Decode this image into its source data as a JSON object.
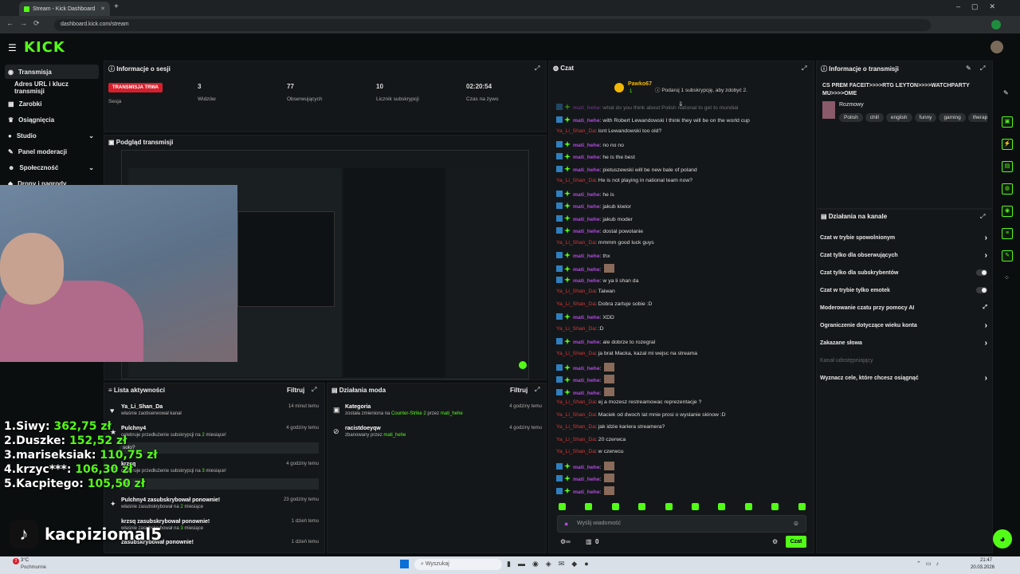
{
  "browser": {
    "tab_title": "Stream - Kick Dashboard",
    "url": "dashboard.kick.com/stream",
    "new_tab": "+"
  },
  "app": {
    "logo": "KICK"
  },
  "sidebar": {
    "items": [
      {
        "label": "Transmisja",
        "icon": "broadcast-icon"
      },
      {
        "label": "Adres URL i klucz transmisji",
        "icon": ""
      },
      {
        "label": "Zarobki",
        "icon": "money-icon"
      },
      {
        "label": "Osiągnięcia",
        "icon": "trophy-icon"
      },
      {
        "label": "Studio",
        "icon": "studio-icon"
      },
      {
        "label": "Panel moderacji",
        "icon": "moderation-icon"
      },
      {
        "label": "Społeczność",
        "icon": "community-icon"
      },
      {
        "label": "Dropy i nagrody",
        "icon": "drops-icon"
      }
    ]
  },
  "session": {
    "title": "Informacje o sesji",
    "status": "TRANSMISJA TRWA",
    "status_label": "Sesja",
    "stats": [
      {
        "value": "3",
        "label": "Widzów"
      },
      {
        "value": "77",
        "label": "Obserwujących"
      },
      {
        "value": "10",
        "label": "Licznik subskrypcji"
      },
      {
        "value": "02:20:54",
        "label": "Czas na żywo"
      }
    ]
  },
  "preview": {
    "title": "Podgląd transmisji"
  },
  "activity": {
    "title": "Lista aktywności",
    "filter": "Filtruj",
    "items": [
      {
        "name": "Ya_Li_Shan_Da",
        "desc": "właśnie zaobserwował kanał",
        "time": "14 minut temu",
        "msg": ""
      },
      {
        "name": "Pulchny4",
        "desc_a": "celebruje przedłużenie subskrypcji na ",
        "count": "2",
        "desc_b": " miesiące!",
        "time": "4 godziny temu",
        "msg": "solo?"
      },
      {
        "name": "krzsq",
        "desc_a": "celebruje przedłużenie subskrypcji na ",
        "count": "3",
        "desc_b": " miesiące!",
        "time": "4 godziny temu",
        "msg": "jol"
      },
      {
        "name": "Pulchny4 zasubskrybował ponownie!",
        "desc_a": "właśnie zasubskrybował na ",
        "count": "2",
        "desc_b": " miesiące",
        "time": "23 godziny temu"
      },
      {
        "name": "krzsq zasubskrybował ponownie!",
        "desc_a": "właśnie zasubskrybował na ",
        "count": "3",
        "desc_b": " miesiące",
        "time": "1 dzień temu"
      },
      {
        "name": "zasubskrybował ponownie!",
        "time": "1 dzień temu"
      }
    ]
  },
  "mod": {
    "title": "Działania moda",
    "filter": "Filtruj",
    "items": [
      {
        "name": "Kategoria",
        "desc_a": "została zmieniona na ",
        "highlight": "Counter-Strike 2",
        "desc_b": " przez ",
        "by": "mati_hehe",
        "time": "4 godziny temu"
      },
      {
        "name": "racistdoeyqw",
        "desc_a": "zbanowany przez ",
        "by": "mati_hehe",
        "time": "4 godziny temu"
      }
    ]
  },
  "chat": {
    "title": "Czat",
    "top_user": "Pawko67",
    "top_count": "1",
    "promo": "Podaruj 1 subskrypcję, aby zdobyć 2.",
    "cut_line": "what do you think about Polish national to get to mundial",
    "lines": [
      {
        "user": "mati_hehe",
        "badge": true,
        "text": "with Robert Lewandowski I think they will be on the world cup"
      },
      {
        "user": "Ya_Li_Shan_Da",
        "badge": false,
        "text": "isnt Lewandowski too old?"
      },
      {
        "user": "mati_hehe",
        "badge": true,
        "text": "no no no"
      },
      {
        "user": "mati_hehe",
        "badge": true,
        "text": "he is the best"
      },
      {
        "user": "mati_hehe",
        "badge": true,
        "text": "pietuszewski will be new bale of poland"
      },
      {
        "user": "Ya_Li_Shan_Da",
        "badge": false,
        "text": "He is not playing in national team now?"
      },
      {
        "user": "mati_hehe",
        "badge": true,
        "text": "he is"
      },
      {
        "user": "mati_hehe",
        "badge": true,
        "text": "jakub kiwior"
      },
      {
        "user": "mati_hehe",
        "badge": true,
        "text": "jakub moder"
      },
      {
        "user": "mati_hehe",
        "badge": true,
        "text": "dostal powolanie"
      },
      {
        "user": "Ya_Li_Shan_Da",
        "badge": false,
        "text": "mmmm good luck guys"
      },
      {
        "user": "mati_hehe",
        "badge": true,
        "text": "thx"
      },
      {
        "user": "mati_hehe",
        "badge": true,
        "text": ""
      },
      {
        "user": "mati_hehe",
        "badge": true,
        "text": "w ya li shan da"
      },
      {
        "user": "Ya_Li_Shan_Da",
        "badge": false,
        "text": "Taiwan"
      },
      {
        "user": "Ya_Li_Shan_Da",
        "badge": false,
        "text": "Dobra zartuje sobie :D"
      },
      {
        "user": "mati_hehe",
        "badge": true,
        "text": "XDD"
      },
      {
        "user": "Ya_Li_Shan_Da",
        "badge": false,
        "text": ":D"
      },
      {
        "user": "mati_hehe",
        "badge": true,
        "text": "ale dobrze to rozegral"
      },
      {
        "user": "Ya_Li_Shan_Da",
        "badge": false,
        "text": "ja brat Macka, kazal mi wejsc na streama"
      },
      {
        "user": "mati_hehe",
        "badge": true,
        "text": ""
      },
      {
        "user": "mati_hehe",
        "badge": true,
        "text": ""
      },
      {
        "user": "mati_hehe",
        "badge": true,
        "text": ""
      },
      {
        "user": "Ya_Li_Shan_Da",
        "badge": false,
        "text": "ej a mozesz restreamowac reprezentacje ?"
      },
      {
        "user": "Ya_Li_Shan_Da",
        "badge": false,
        "text": "Maciek od dwoch lat mnie prosi o wyslanie skinow :D"
      },
      {
        "user": "Ya_Li_Shan_Da",
        "badge": false,
        "text": "jak idzie kariera streamera?"
      },
      {
        "user": "Ya_Li_Shan_Da",
        "badge": false,
        "text": "20 czerwca"
      },
      {
        "user": "Ya_Li_Shan_Da",
        "badge": false,
        "text": "w czerwcu"
      },
      {
        "user": "mati_hehe",
        "badge": true,
        "text": ""
      },
      {
        "user": "mati_hehe",
        "badge": true,
        "text": ""
      },
      {
        "user": "mati_hehe",
        "badge": true,
        "text": ""
      }
    ],
    "input_placeholder": "Wyślij wiadomość",
    "points": "0",
    "send": "Czat"
  },
  "stream_info": {
    "title": "Informacje o transmisji",
    "stream_title": "CS PREM FACEIT>>>>RTG LEYTON>>>>WATCHPARTY MU>>>>OME",
    "category": "Rozmowy",
    "tags": [
      "Polish",
      "chill",
      "english",
      "funny",
      "gaming",
      "therap"
    ]
  },
  "channel": {
    "title": "Działania na kanale",
    "options": [
      {
        "label": "Czat w trybie spowolnionym",
        "kind": "arrow"
      },
      {
        "label": "Czat tylko dla obserwujących",
        "kind": "arrow"
      },
      {
        "label": "Czat tylko dla subskrybentów",
        "kind": "toggle"
      },
      {
        "label": "Czat w trybie tylko emotek",
        "kind": "toggle"
      },
      {
        "label": "Moderowanie czatu przy pomocy AI",
        "kind": "external"
      },
      {
        "label": "Ograniczenie dotyczące wieku konta",
        "kind": "arrow"
      },
      {
        "label": "Zakazane słowa",
        "kind": "arrow"
      },
      {
        "label": "Kanał udostępniający",
        "kind": "disabled"
      },
      {
        "label": "Wyznacz cele, które chcesz osiągnąć",
        "kind": "arrow"
      }
    ]
  },
  "overlay": {
    "leaderboard": [
      {
        "rank": "1.",
        "name": "Siwy:",
        "amount": "362,75 zł"
      },
      {
        "rank": "2.",
        "name": "Duszke:",
        "amount": "152,52 zł"
      },
      {
        "rank": "3.",
        "name": "mariseksiak:",
        "amount": "110,75 zł"
      },
      {
        "rank": "4.",
        "name": "krzyc***:",
        "amount": "106,30 zł"
      },
      {
        "rank": "5.",
        "name": "Kacpitego:",
        "amount": "105,50 zł"
      }
    ],
    "tiktok_handle": "kacpiziomal5"
  },
  "taskbar": {
    "weather_temp": "3°C",
    "weather_desc": "Pochmurnie",
    "notif": "2",
    "search": "Wyszukaj",
    "time": "21:47",
    "date": "20.03.2026"
  }
}
